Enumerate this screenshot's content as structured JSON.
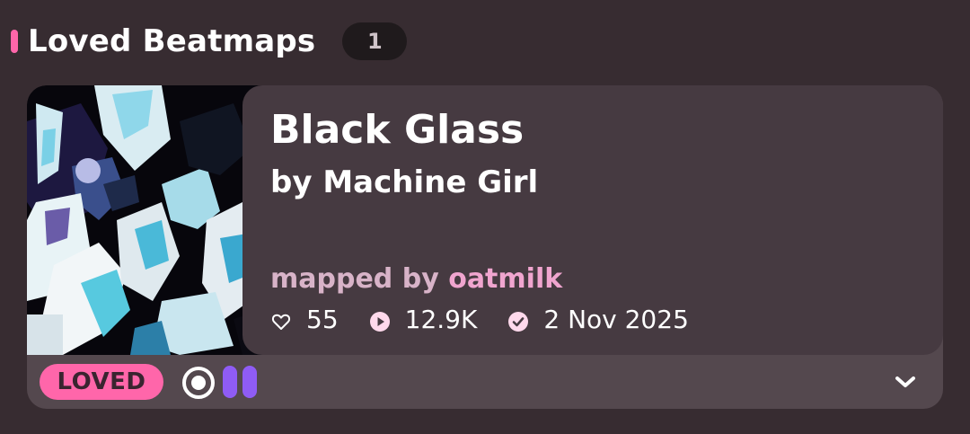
{
  "section": {
    "title": "Loved Beatmaps",
    "count": "1",
    "accent_color": "#ff66aa"
  },
  "beatmap": {
    "title": "Black Glass",
    "artist_line": "by Machine Girl",
    "mapped_by_prefix": "mapped by ",
    "mapper": "oatmilk",
    "stats": {
      "favourites": "55",
      "favourites_icon": "heart-outline-icon",
      "plays": "12.9K",
      "plays_icon": "play-circle-icon",
      "date": "2 Nov 2025",
      "date_icon": "check-circle-icon"
    },
    "status": "LOVED",
    "status_color": "#ff66aa",
    "mode_icon": "osu-standard-mode-icon",
    "difficulty_count": 2,
    "difficulty_color": "#8f5cf5",
    "expand_icon": "chevron-down-icon"
  }
}
